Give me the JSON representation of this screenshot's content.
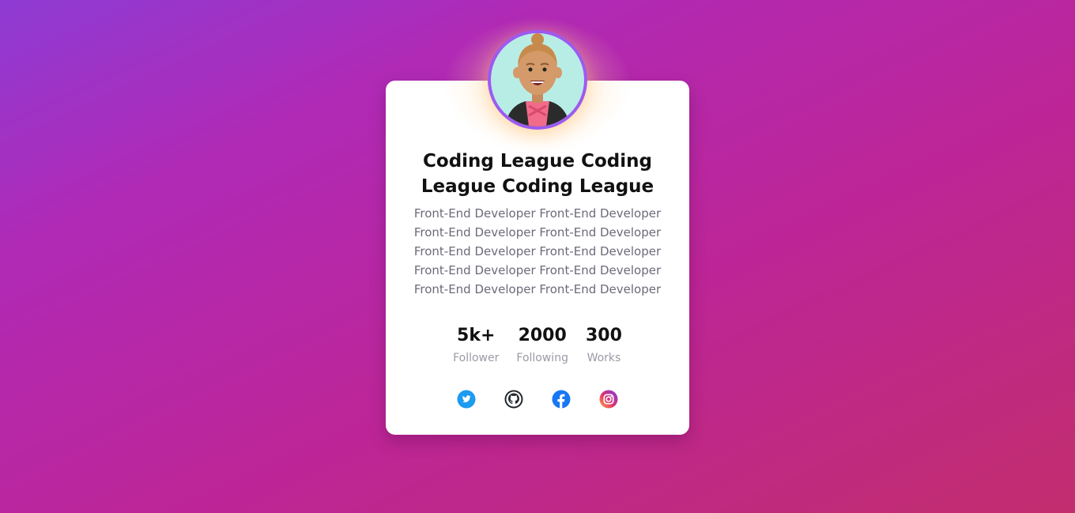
{
  "profile": {
    "name": "Coding League Coding League Coding League",
    "role": "Front-End Developer Front-End Developer Front-End Developer Front-End Developer Front-End Developer Front-End Developer Front-End Developer Front-End Developer Front-End Developer Front-End Developer"
  },
  "stats": [
    {
      "value": "5k+",
      "label": "Follower"
    },
    {
      "value": "2000",
      "label": "Following"
    },
    {
      "value": "300",
      "label": "Works"
    }
  ],
  "socials": [
    {
      "icon": "twitter-icon",
      "color": "#1d9bf0"
    },
    {
      "icon": "github-icon",
      "color": "#24292f"
    },
    {
      "icon": "facebook-icon",
      "color": "#1877f2"
    },
    {
      "icon": "instagram-icon",
      "color": "#e1306c"
    }
  ],
  "colors": {
    "avatar_ring": "#9d5af0",
    "avatar_bg": "#b8ede6"
  }
}
